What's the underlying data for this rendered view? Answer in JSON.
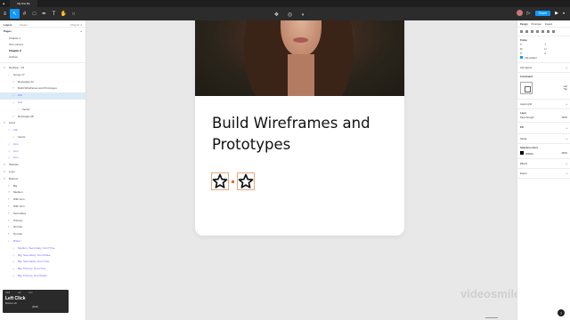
{
  "titlebar": {
    "tab_label": "My first file"
  },
  "toolbar": {
    "share_label": "Share"
  },
  "left_panel": {
    "tabs": [
      "Layers",
      "Assets"
    ],
    "page_indicator": "Chapter 2",
    "pages_header": "Pages",
    "pages": [
      "Chapter 1",
      "Text content",
      "Chapter 2",
      "Archive"
    ],
    "layers": [
      {
        "label": "Desktop - 19",
        "type": "frame"
      },
      {
        "label": "Group 17",
        "type": "group"
      },
      {
        "label": "Rectangle 24",
        "type": "rect"
      },
      {
        "label": "Build Wireframes and Prototypes",
        "type": "text"
      },
      {
        "label": "star",
        "type": "component"
      },
      {
        "label": "star",
        "type": "component"
      },
      {
        "label": "Vector",
        "type": "vector"
      },
      {
        "label": "Rectangle 28",
        "type": "rect"
      },
      {
        "label": "Icons",
        "type": "frame"
      },
      {
        "label": "star",
        "type": "component"
      },
      {
        "label": "Vector",
        "type": "vector"
      },
      {
        "label": "icon",
        "type": "component"
      },
      {
        "label": "icon",
        "type": "component"
      },
      {
        "label": "icon",
        "type": "component"
      },
      {
        "label": "Website",
        "type": "frame"
      },
      {
        "label": "Logo",
        "type": "frame"
      },
      {
        "label": "Buttons",
        "type": "frame"
      },
      {
        "label": "Big",
        "type": "text"
      },
      {
        "label": "Medium",
        "type": "text"
      },
      {
        "label": "With Icon",
        "type": "text"
      },
      {
        "label": "With Icon",
        "type": "text"
      },
      {
        "label": "Secondary",
        "type": "text"
      },
      {
        "label": "Primary",
        "type": "text"
      },
      {
        "label": "Normal",
        "type": "text"
      },
      {
        "label": "Normal",
        "type": "text"
      },
      {
        "label": "Button",
        "type": "component"
      },
      {
        "label": "Medium, Secondary, Icon=True",
        "type": "component"
      },
      {
        "label": "Big, Secondary, Icon=False",
        "type": "component"
      },
      {
        "label": "Big, Secondary, Icon=True",
        "type": "component"
      },
      {
        "label": "Big, Primary, Icon=True",
        "type": "component"
      },
      {
        "label": "Big, Primary, Icon=False",
        "type": "component"
      }
    ],
    "selected_layer_index": 4
  },
  "tooltip": {
    "headers": [
      "Shift",
      "Alt",
      "Ctrl"
    ],
    "title": "Left Click",
    "subtitle": "Mouse Left",
    "key": "[Shift]"
  },
  "canvas": {
    "heading": "Build Wireframes and Prototypes",
    "watermark": "videosmile",
    "star_color": "#111111",
    "selection_color": "#f06a2a"
  },
  "right_panel": {
    "tabs": [
      "Design",
      "Prototype",
      "Inspect"
    ],
    "frame_title": "Frame",
    "frame_fields": [
      "X",
      "Y",
      "W",
      "H",
      "0°",
      "0"
    ],
    "clip_label": "Clip content",
    "auto_layout_label": "Auto layout",
    "constraints_title": "Constraints",
    "constraints_left": "Left",
    "constraints_top": "Top",
    "layout_grid_label": "Layout grid",
    "layer_title": "Layer",
    "pass_through": "Pass through",
    "opacity": "100%",
    "fill_title": "Fill",
    "stroke_title": "Stroke",
    "selection_colors_title": "Selection colors",
    "fill_hex": "000000",
    "fill_opacity": "100%",
    "effects_title": "Effects",
    "export_title": "Export"
  }
}
